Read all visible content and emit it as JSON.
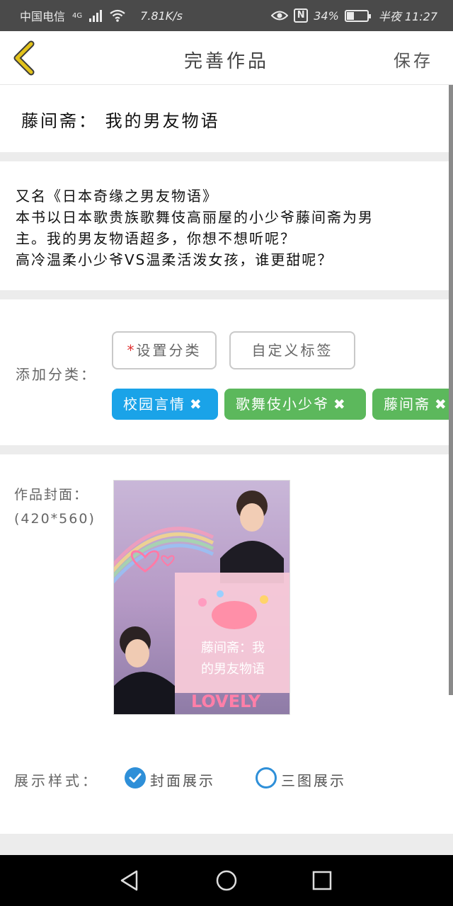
{
  "status_bar": {
    "carrier": "中国电信",
    "network": "4G",
    "speed": "7.81K/s",
    "battery": "34%",
    "battery_level": 0.34,
    "time": "半夜 11:27",
    "icons": [
      "signal-icon",
      "wifi-icon",
      "eye-icon",
      "nfc-icon",
      "battery-icon"
    ]
  },
  "nav": {
    "title": "完善作品",
    "save_label": "保存",
    "back_icon": "chevron-left-icon",
    "accent": "#d4b400"
  },
  "work": {
    "title": "藤间斋： 我的男友物语"
  },
  "description": {
    "lines": [
      "又名《日本奇缘之男友物语》",
      "本书以日本歌贵族歌舞伎高丽屋的小少爷藤间斋为男",
      "主。我的男友物语超多，你想不想听呢？",
      "高冷温柔小少爷VS温柔活泼女孩，谁更甜呢？"
    ]
  },
  "category": {
    "label": "添加分类：",
    "required_mark": "*",
    "set_category_label": "设置分类",
    "custom_tag_label": "自定义标签",
    "tags": [
      {
        "label": "校园言情",
        "color": "#1aa3e8"
      },
      {
        "label": "歌舞伎小少爷",
        "color": "#5cb85c"
      },
      {
        "label": "藤间斋",
        "color": "#5cb85c"
      }
    ],
    "remove_icon": "close-icon"
  },
  "cover": {
    "label": "作品封面：",
    "size_hint": "(420*560)",
    "image_text_1": "藤间斋：我",
    "image_text_2": "的男友物语",
    "image_brand": "LOVELY"
  },
  "display_style": {
    "label": "展示样式：",
    "options": [
      {
        "label": "封面展示",
        "selected": true
      },
      {
        "label": "三图展示",
        "selected": false
      }
    ],
    "color": "#2e8fd8"
  }
}
